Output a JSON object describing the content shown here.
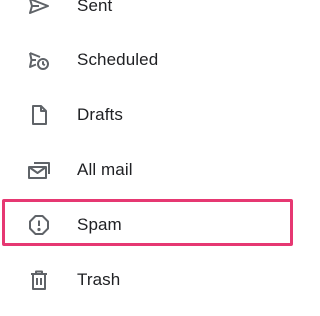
{
  "highlight_color": "#e63872",
  "nav": {
    "items": [
      {
        "label": "Sent",
        "icon": "send-icon"
      },
      {
        "label": "Scheduled",
        "icon": "scheduled-send-icon"
      },
      {
        "label": "Drafts",
        "icon": "draft-icon"
      },
      {
        "label": "All mail",
        "icon": "all-mail-icon"
      },
      {
        "label": "Spam",
        "icon": "spam-icon",
        "highlighted": true
      },
      {
        "label": "Trash",
        "icon": "trash-icon"
      }
    ]
  }
}
